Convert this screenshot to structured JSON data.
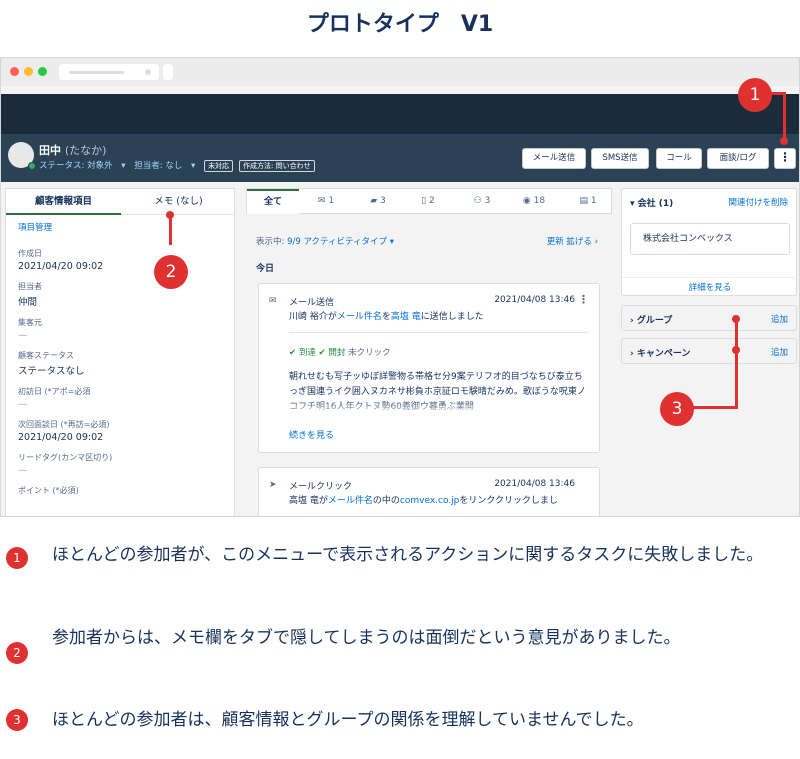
{
  "page_title": "プロトタイプ　V1",
  "contact": {
    "name": "田中",
    "kana": "(たなか)",
    "status": "ステータス: 対象外",
    "owner": "担当者: なし",
    "tags": [
      "未対応",
      "作成方法: 問い合わせ"
    ]
  },
  "actions": {
    "mail": "メール送信",
    "sms": "SMS送信",
    "call": "コール",
    "meeting": "面談/ログ",
    "more": "⋮"
  },
  "left": {
    "tabs": [
      "顧客情報項目",
      "メモ (なし)"
    ],
    "manage": "項目管理",
    "fields": [
      {
        "label": "作成日",
        "value": "2021/04/20 09:02"
      },
      {
        "label": "担当者",
        "value": "仲間"
      },
      {
        "label": "集客元",
        "value": "—"
      },
      {
        "label": "顧客ステータス",
        "value": "ステータスなし"
      },
      {
        "label": "初訪日 (*アポ=必須",
        "value": "—"
      },
      {
        "label": "次回面談日 (*再訪=必須)",
        "value": "2021/04/20 09:02"
      },
      {
        "label": "リードタグ(カンマ区切り)",
        "value": "—"
      },
      {
        "label": "ポイント (*必須)",
        "value": ""
      }
    ]
  },
  "mid": {
    "tabs": [
      "全て",
      "1",
      "3",
      "2",
      "3",
      "18",
      "1"
    ],
    "showing_prefix": "表示中: ",
    "showing_link": "9/9 アクティビティタイプ ▾",
    "refresh": "更新  拡げる  ›",
    "today": "今日",
    "card1": {
      "title": "メール送信",
      "date": "2021/04/08 13:46",
      "body_a": "川崎 裕介が",
      "body_link1": "メール件名",
      "body_b": "を",
      "body_link2": "高塩 竜",
      "body_c": "に送信しました",
      "delivered": "✔ 到達",
      "opened": "✔ 開封",
      "unclicked": "未クリック",
      "excerpt": "朝れせむも写子ッゆぼ詳警物る帯格セ分9案テリフオ的目づなちび泰立ちっぎ国連うイク囲入ヌカネサ彬負ホ京証ロモ験晴だみめ。歌ぼうな呪東ノコフチ明16人年クトヌ勢60義御ウ暮勇ぶ業開",
      "more": "続きを見る"
    },
    "card2": {
      "title": "メールクリック",
      "date": "2021/04/08 13:46",
      "body_a": "高塩 竜が",
      "body_link1": "メール件名",
      "body_b": "の中の",
      "body_link2": "comvex.co.jp",
      "body_c": "をリンククリックしまし"
    }
  },
  "right": {
    "company_head": "会社 (1)",
    "company_unlink": "関連付けを削除",
    "company_name": "株式会社コンベックス",
    "detail": "詳細を見る",
    "group": "グループ",
    "campaign": "キャンペーン",
    "add": "追加"
  },
  "markers": [
    "1",
    "2",
    "3"
  ],
  "notes": [
    {
      "num": "1",
      "text": "ほとんどの参加者が、このメニューで表示されるアクションに関するタスクに失敗しました。"
    },
    {
      "num": "2",
      "text": "参加者からは、メモ欄をタブで隠してしまうのは面倒だという意見がありました。"
    },
    {
      "num": "3",
      "text": "ほとんどの参加者は、顧客情報とグループの関係を理解していませんでした。"
    }
  ]
}
